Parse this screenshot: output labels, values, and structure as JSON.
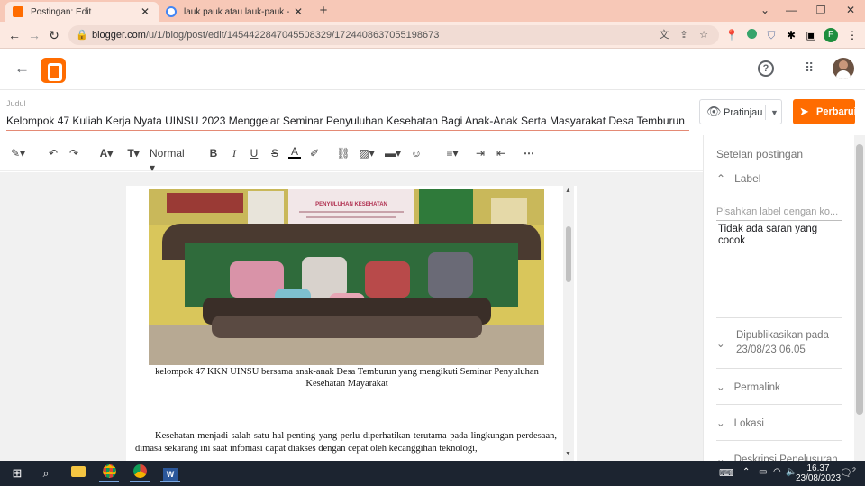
{
  "browser": {
    "tabs": [
      {
        "title": "Postingan: Edit",
        "active": true
      },
      {
        "title": "lauk pauk atau lauk-pauk - Penel",
        "active": false
      }
    ],
    "new_tab": "+",
    "url_host": "blogger.com",
    "url_path": "/u/1/blog/post/edit/1454422847045508329/1724408637055198673",
    "profile_initial": "F"
  },
  "app": {
    "accent": "#ff6c00"
  },
  "editor": {
    "title_label": "Judul",
    "title_value": "Kelompok 47 Kuliah Kerja Nyata UINSU 2023 Menggelar Seminar Penyuluhan Kesehatan Bagi Anak-Anak Serta Masyarakat Desa Temburun",
    "preview_label": "Pratinjau",
    "publish_label": "Perbarui",
    "format_value": "Normal",
    "photo_banner": "PENYULUHAN KESEHATAN",
    "caption_line1": "kelompok 47 KKN UINSU bersama anak-anak Desa Temburun yang mengikuti Seminar Penyuluhan",
    "caption_line2": "Kesehatan Mayarakat",
    "paragraph": "Kesehatan menjadi salah satu hal penting yang perlu diperhatikan terutama pada lingkungan perdesaan, dimasa sekarang ini saat infomasi dapat diakses dengan cepat oleh kecanggihan teknologi,"
  },
  "settings": {
    "heading": "Setelan postingan",
    "label_section": "Label",
    "label_placeholder": "Pisahkan label dengan ko...",
    "label_empty": "Tidak ada saran yang cocok",
    "published_title": "Dipublikasikan pada",
    "published_value": "23/08/23 06.05",
    "permalink": "Permalink",
    "location": "Lokasi",
    "search_desc": "Deskripsi Penelusuran"
  },
  "taskbar": {
    "time": "16.37",
    "date": "23/08/2023",
    "notif_count": "2"
  }
}
